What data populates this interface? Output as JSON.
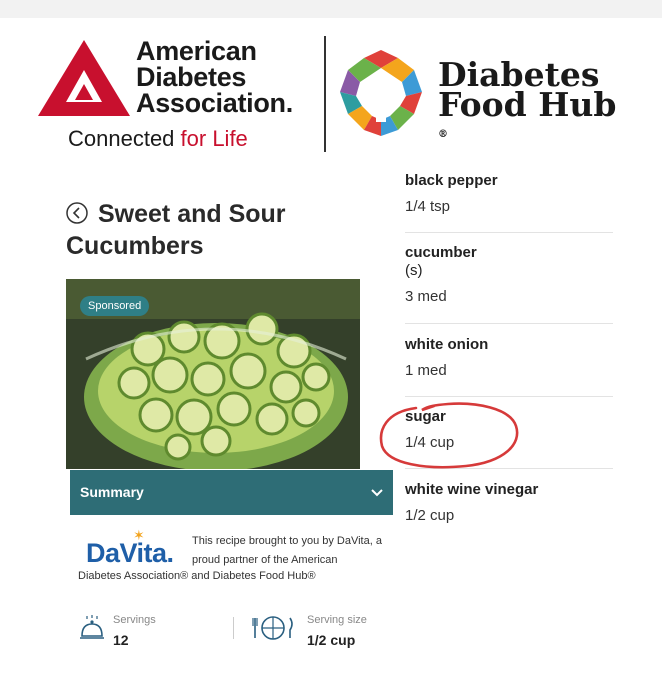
{
  "header": {
    "ada_name_lines": [
      "American",
      "Diabetes",
      "Association."
    ],
    "ada_tagline_prefix": "Connected ",
    "ada_tagline_highlight": "for Life",
    "dfh_name_lines": [
      "Diabetes",
      "Food Hub"
    ],
    "reg_mark": "®"
  },
  "recipe": {
    "title": "Sweet and Sour Cucumbers",
    "sponsored_label": "Sponsored",
    "summary_label": "Summary",
    "sponsor_logo_text": "DaVita.",
    "sponsor_text": "This recipe brought to you by DaVita, a proud partner of the American",
    "sponsor_text_cont": "Diabetes Association® and Diabetes Food Hub®",
    "servings_label": "Servings",
    "servings_value": "12",
    "serving_size_label": "Serving size",
    "serving_size_value": "1/2 cup"
  },
  "ingredients": [
    {
      "name": "black pepper",
      "sub": "",
      "amount": "1/4 tsp"
    },
    {
      "name": "cucumber",
      "sub": "(s)",
      "amount": "3 med"
    },
    {
      "name": "white onion",
      "sub": "",
      "amount": "1 med"
    },
    {
      "name": "sugar",
      "sub": "",
      "amount": "1/4 cup"
    },
    {
      "name": "white wine vinegar",
      "sub": "",
      "amount": "1/2 cup"
    }
  ],
  "colors": {
    "ada_red": "#c8102e",
    "summary_teal": "#2e6d76",
    "sponsored_teal": "#2f7f86",
    "davita_blue": "#1f5fa8",
    "annotation_red": "#d63a3a"
  },
  "icons": [
    "back-chevron-icon",
    "chevron-down-icon",
    "serving-cloche-icon",
    "plate-utensils-icon"
  ]
}
